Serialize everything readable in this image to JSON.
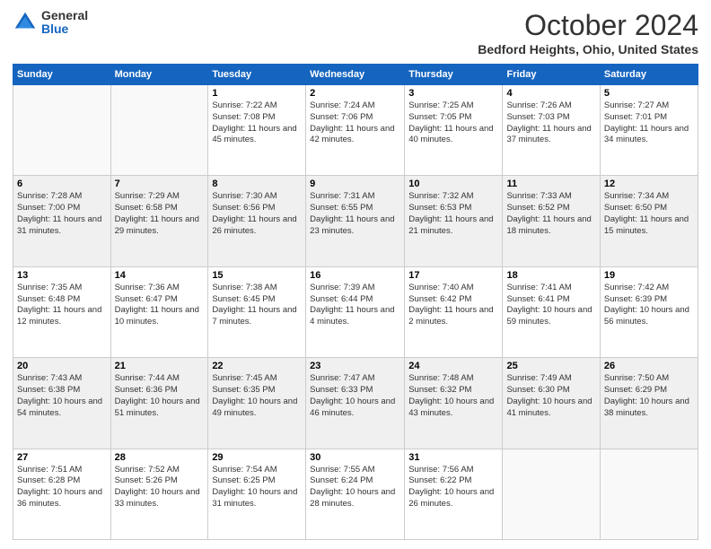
{
  "logo": {
    "general": "General",
    "blue": "Blue"
  },
  "header": {
    "month": "October 2024",
    "location": "Bedford Heights, Ohio, United States"
  },
  "weekdays": [
    "Sunday",
    "Monday",
    "Tuesday",
    "Wednesday",
    "Thursday",
    "Friday",
    "Saturday"
  ],
  "weeks": [
    [
      {
        "day": "",
        "sunrise": "",
        "sunset": "",
        "daylight": ""
      },
      {
        "day": "",
        "sunrise": "",
        "sunset": "",
        "daylight": ""
      },
      {
        "day": "1",
        "sunrise": "Sunrise: 7:22 AM",
        "sunset": "Sunset: 7:08 PM",
        "daylight": "Daylight: 11 hours and 45 minutes."
      },
      {
        "day": "2",
        "sunrise": "Sunrise: 7:24 AM",
        "sunset": "Sunset: 7:06 PM",
        "daylight": "Daylight: 11 hours and 42 minutes."
      },
      {
        "day": "3",
        "sunrise": "Sunrise: 7:25 AM",
        "sunset": "Sunset: 7:05 PM",
        "daylight": "Daylight: 11 hours and 40 minutes."
      },
      {
        "day": "4",
        "sunrise": "Sunrise: 7:26 AM",
        "sunset": "Sunset: 7:03 PM",
        "daylight": "Daylight: 11 hours and 37 minutes."
      },
      {
        "day": "5",
        "sunrise": "Sunrise: 7:27 AM",
        "sunset": "Sunset: 7:01 PM",
        "daylight": "Daylight: 11 hours and 34 minutes."
      }
    ],
    [
      {
        "day": "6",
        "sunrise": "Sunrise: 7:28 AM",
        "sunset": "Sunset: 7:00 PM",
        "daylight": "Daylight: 11 hours and 31 minutes."
      },
      {
        "day": "7",
        "sunrise": "Sunrise: 7:29 AM",
        "sunset": "Sunset: 6:58 PM",
        "daylight": "Daylight: 11 hours and 29 minutes."
      },
      {
        "day": "8",
        "sunrise": "Sunrise: 7:30 AM",
        "sunset": "Sunset: 6:56 PM",
        "daylight": "Daylight: 11 hours and 26 minutes."
      },
      {
        "day": "9",
        "sunrise": "Sunrise: 7:31 AM",
        "sunset": "Sunset: 6:55 PM",
        "daylight": "Daylight: 11 hours and 23 minutes."
      },
      {
        "day": "10",
        "sunrise": "Sunrise: 7:32 AM",
        "sunset": "Sunset: 6:53 PM",
        "daylight": "Daylight: 11 hours and 21 minutes."
      },
      {
        "day": "11",
        "sunrise": "Sunrise: 7:33 AM",
        "sunset": "Sunset: 6:52 PM",
        "daylight": "Daylight: 11 hours and 18 minutes."
      },
      {
        "day": "12",
        "sunrise": "Sunrise: 7:34 AM",
        "sunset": "Sunset: 6:50 PM",
        "daylight": "Daylight: 11 hours and 15 minutes."
      }
    ],
    [
      {
        "day": "13",
        "sunrise": "Sunrise: 7:35 AM",
        "sunset": "Sunset: 6:48 PM",
        "daylight": "Daylight: 11 hours and 12 minutes."
      },
      {
        "day": "14",
        "sunrise": "Sunrise: 7:36 AM",
        "sunset": "Sunset: 6:47 PM",
        "daylight": "Daylight: 11 hours and 10 minutes."
      },
      {
        "day": "15",
        "sunrise": "Sunrise: 7:38 AM",
        "sunset": "Sunset: 6:45 PM",
        "daylight": "Daylight: 11 hours and 7 minutes."
      },
      {
        "day": "16",
        "sunrise": "Sunrise: 7:39 AM",
        "sunset": "Sunset: 6:44 PM",
        "daylight": "Daylight: 11 hours and 4 minutes."
      },
      {
        "day": "17",
        "sunrise": "Sunrise: 7:40 AM",
        "sunset": "Sunset: 6:42 PM",
        "daylight": "Daylight: 11 hours and 2 minutes."
      },
      {
        "day": "18",
        "sunrise": "Sunrise: 7:41 AM",
        "sunset": "Sunset: 6:41 PM",
        "daylight": "Daylight: 10 hours and 59 minutes."
      },
      {
        "day": "19",
        "sunrise": "Sunrise: 7:42 AM",
        "sunset": "Sunset: 6:39 PM",
        "daylight": "Daylight: 10 hours and 56 minutes."
      }
    ],
    [
      {
        "day": "20",
        "sunrise": "Sunrise: 7:43 AM",
        "sunset": "Sunset: 6:38 PM",
        "daylight": "Daylight: 10 hours and 54 minutes."
      },
      {
        "day": "21",
        "sunrise": "Sunrise: 7:44 AM",
        "sunset": "Sunset: 6:36 PM",
        "daylight": "Daylight: 10 hours and 51 minutes."
      },
      {
        "day": "22",
        "sunrise": "Sunrise: 7:45 AM",
        "sunset": "Sunset: 6:35 PM",
        "daylight": "Daylight: 10 hours and 49 minutes."
      },
      {
        "day": "23",
        "sunrise": "Sunrise: 7:47 AM",
        "sunset": "Sunset: 6:33 PM",
        "daylight": "Daylight: 10 hours and 46 minutes."
      },
      {
        "day": "24",
        "sunrise": "Sunrise: 7:48 AM",
        "sunset": "Sunset: 6:32 PM",
        "daylight": "Daylight: 10 hours and 43 minutes."
      },
      {
        "day": "25",
        "sunrise": "Sunrise: 7:49 AM",
        "sunset": "Sunset: 6:30 PM",
        "daylight": "Daylight: 10 hours and 41 minutes."
      },
      {
        "day": "26",
        "sunrise": "Sunrise: 7:50 AM",
        "sunset": "Sunset: 6:29 PM",
        "daylight": "Daylight: 10 hours and 38 minutes."
      }
    ],
    [
      {
        "day": "27",
        "sunrise": "Sunrise: 7:51 AM",
        "sunset": "Sunset: 6:28 PM",
        "daylight": "Daylight: 10 hours and 36 minutes."
      },
      {
        "day": "28",
        "sunrise": "Sunrise: 7:52 AM",
        "sunset": "Sunset: 5:26 PM",
        "daylight": "Daylight: 10 hours and 33 minutes."
      },
      {
        "day": "29",
        "sunrise": "Sunrise: 7:54 AM",
        "sunset": "Sunset: 6:25 PM",
        "daylight": "Daylight: 10 hours and 31 minutes."
      },
      {
        "day": "30",
        "sunrise": "Sunrise: 7:55 AM",
        "sunset": "Sunset: 6:24 PM",
        "daylight": "Daylight: 10 hours and 28 minutes."
      },
      {
        "day": "31",
        "sunrise": "Sunrise: 7:56 AM",
        "sunset": "Sunset: 6:22 PM",
        "daylight": "Daylight: 10 hours and 26 minutes."
      },
      {
        "day": "",
        "sunrise": "",
        "sunset": "",
        "daylight": ""
      },
      {
        "day": "",
        "sunrise": "",
        "sunset": "",
        "daylight": ""
      }
    ]
  ]
}
